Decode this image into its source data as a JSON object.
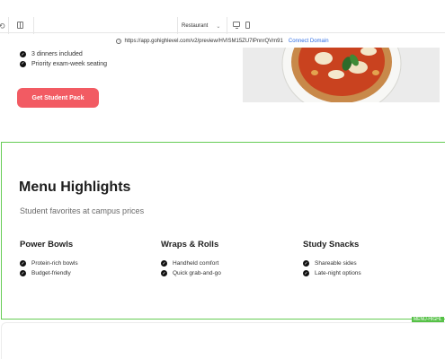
{
  "toolbar": {
    "page_selector": "Restaurant",
    "url": "https://app.gohighlevel.com/v2/preview/HVISM15ZU7lPnnrQVm91",
    "connect_domain": "Connect Domain"
  },
  "hero": {
    "features": [
      "3 dinners included",
      "Priority exam-week seating"
    ],
    "cta_label": "Get Student Pack"
  },
  "menu": {
    "title": "Menu Highlights",
    "subtitle": "Student favorites at campus prices",
    "columns": [
      {
        "heading": "Power Bowls",
        "items": [
          "Protein-rich bowls",
          "Budget-friendly"
        ]
      },
      {
        "heading": "Wraps & Rolls",
        "items": [
          "Handheld comfort",
          "Quick grab-and-go"
        ]
      },
      {
        "heading": "Study Snacks",
        "items": [
          "Shareable sides",
          "Late-night options"
        ]
      }
    ],
    "selection_tag": "MENU-HIGHL"
  },
  "colors": {
    "cta": "#f25b63",
    "selection": "#55c146",
    "link": "#2f6ee5"
  },
  "icons": {
    "check": "check-circle-icon",
    "info": "info-icon",
    "desktop": "desktop-icon",
    "mobile": "mobile-icon"
  }
}
